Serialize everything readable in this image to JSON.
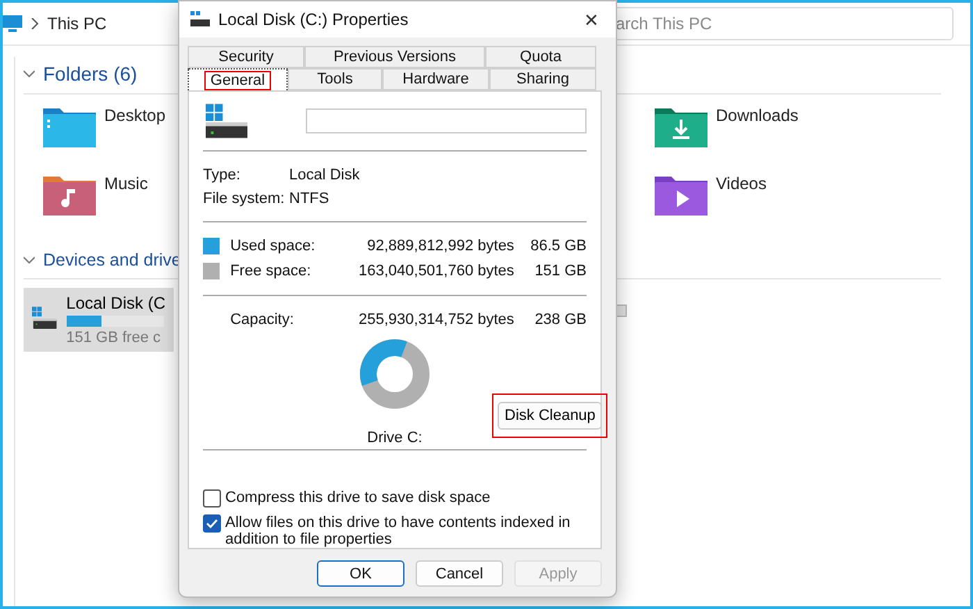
{
  "explorer": {
    "breadcrumb": [
      "This PC"
    ],
    "search": {
      "placeholder": "arch This PC"
    },
    "folders_header": "Folders (6)",
    "folders": [
      {
        "name": "Desktop",
        "kind": "desktop"
      },
      {
        "name": "Music",
        "kind": "music"
      },
      {
        "name": "Downloads",
        "kind": "downloads"
      },
      {
        "name": "Videos",
        "kind": "videos"
      }
    ],
    "devices_header": "Devices and drive",
    "drives": [
      {
        "name": "Local Disk (C",
        "free": "151 GB free c",
        "level": 0.36,
        "selected": true
      }
    ]
  },
  "dialog": {
    "title": "Local Disk (C:) Properties",
    "close": "✕",
    "tabs_back": [
      {
        "label": "Security",
        "selected": false
      },
      {
        "label": "Previous Versions",
        "selected": false
      },
      {
        "label": "Quota",
        "selected": false
      }
    ],
    "tabs_front": [
      {
        "label": "General",
        "selected": true
      },
      {
        "label": "Tools",
        "selected": false
      },
      {
        "label": "Hardware",
        "selected": false
      },
      {
        "label": "Sharing",
        "selected": false
      }
    ],
    "info": [
      {
        "label": "Type:",
        "value": "Local Disk"
      },
      {
        "label": "File system:",
        "value": "NTFS"
      }
    ],
    "space": [
      {
        "label": "Used space:",
        "bytes": "92,889,812,992 bytes",
        "size": "86.5 GB",
        "color": "#26a0da"
      },
      {
        "label": "Free space:",
        "bytes": "163,040,501,760 bytes",
        "size": "151 GB",
        "color": "#b0b0b0"
      }
    ],
    "capacity": {
      "label": "Capacity:",
      "bytes": "255,930,314,752 bytes",
      "size": "238 GB"
    },
    "usage": {
      "level": 0.363
    },
    "drive_label": "Drive C:",
    "cleanup_button": "Disk Cleanup",
    "options": [
      {
        "label": "Compress this drive to save disk space",
        "checked": false
      },
      {
        "label": "Allow files on this drive to have contents indexed in addition to file properties",
        "checked": true
      }
    ],
    "buttons": [
      {
        "label": "OK",
        "disabled": false
      },
      {
        "label": "Cancel",
        "disabled": false
      },
      {
        "label": "Apply",
        "disabled": true
      }
    ]
  }
}
